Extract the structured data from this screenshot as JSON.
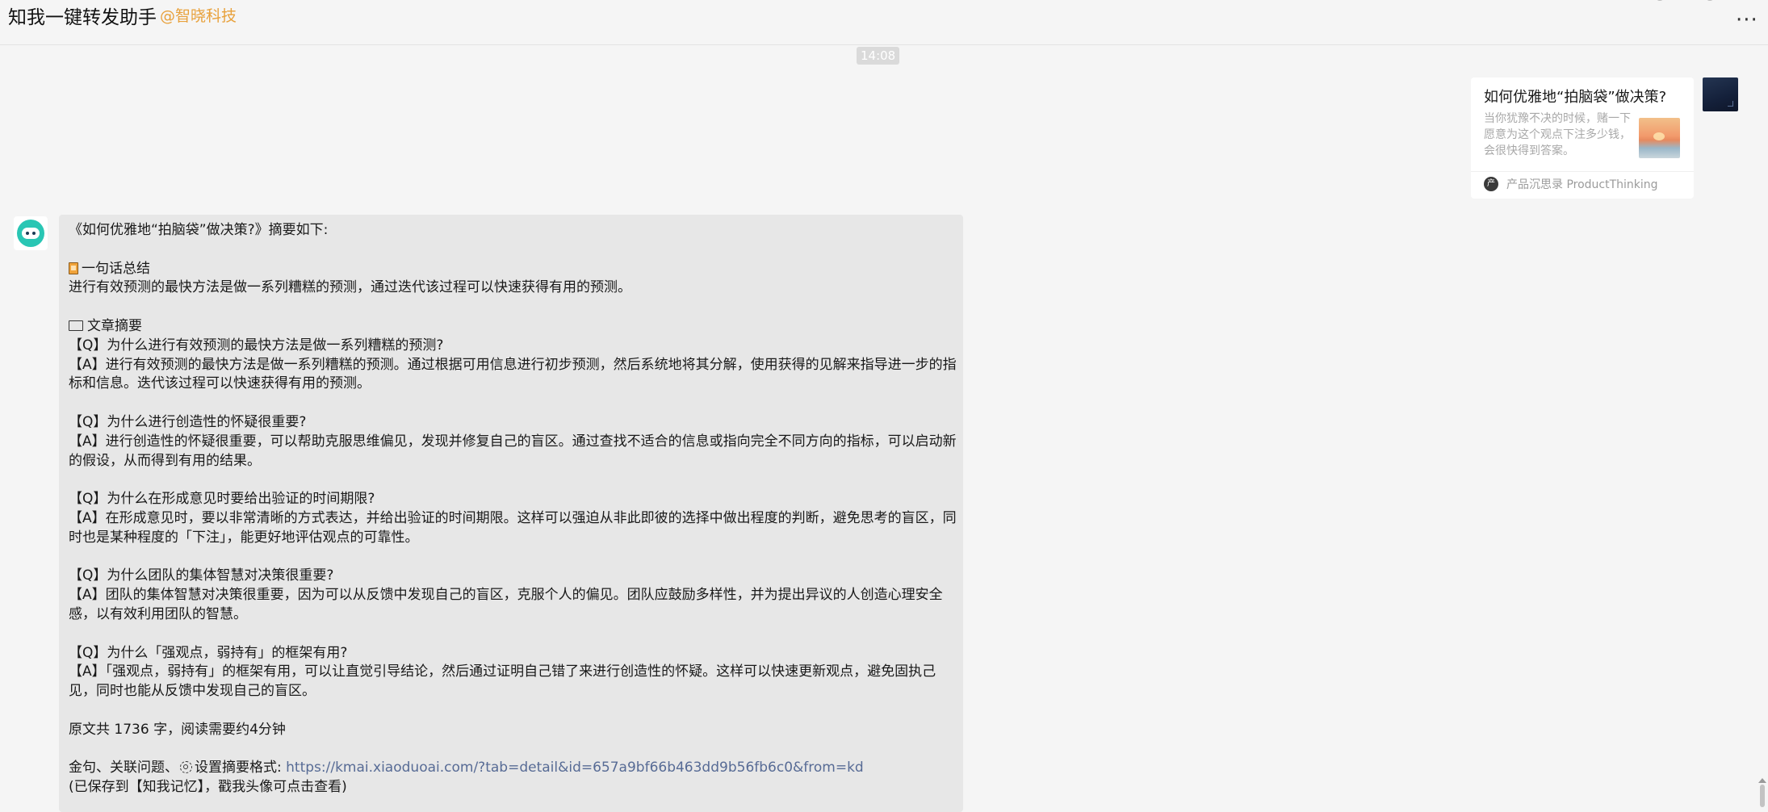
{
  "header": {
    "title": "知我一键转发助手",
    "org": "@智晓科技",
    "more_label": "···"
  },
  "timestamp": "14:08",
  "share_card": {
    "title": "如何优雅地“拍脑袋”做决策?",
    "description": "当你犹豫不决的时候，赌一下愿意为这个观点下注多少钱，会很快得到答案。",
    "source_icon": "产",
    "source": "产品沉思录 ProductThinking"
  },
  "message": {
    "intro": "《如何优雅地“拍脑袋”做决策?》摘要如下:",
    "summary_heading": "一句话总结",
    "summary_text": "进行有效预测的最快方法是做一系列糟糕的预测，通过迭代该过程可以快速获得有用的预测。",
    "article_heading": "文章摘要",
    "qa": [
      {
        "q": "【Q】为什么进行有效预测的最快方法是做一系列糟糕的预测?",
        "a": "【A】进行有效预测的最快方法是做一系列糟糕的预测。通过根据可用信息进行初步预测，然后系统地将其分解，使用获得的见解来指导进一步的指标和信息。迭代该过程可以快速获得有用的预测。"
      },
      {
        "q": "【Q】为什么进行创造性的怀疑很重要?",
        "a": "【A】进行创造性的怀疑很重要，可以帮助克服思维偏见，发现并修复自己的盲区。通过查找不适合的信息或指向完全不同方向的指标，可以启动新的假设，从而得到有用的结果。"
      },
      {
        "q": "【Q】为什么在形成意见时要给出验证的时间期限?",
        "a": "【A】在形成意见时，要以非常清晰的方式表达，并给出验证的时间期限。这样可以强迫从非此即彼的选择中做出程度的判断，避免思考的盲区，同时也是某种程度的「下注」，能更好地评估观点的可靠性。"
      },
      {
        "q": "【Q】为什么团队的集体智慧对决策很重要?",
        "a": "【A】团队的集体智慧对决策很重要，因为可以从反馈中发现自己的盲区，克服个人的偏见。团队应鼓励多样性，并为提出异议的人创造心理安全感，以有效利用团队的智慧。"
      },
      {
        "q": "【Q】为什么「强观点，弱持有」的框架有用?",
        "a": "【A】「强观点，弱持有」的框架有用，可以让直觉引导结论，然后通过证明自己错了来进行创造性的怀疑。这样可以快速更新观点，避免固执己见，同时也能从反馈中发现自己的盲区。"
      }
    ],
    "word_count": "原文共 1736 字，阅读需要约4分钟",
    "settings_prefix": "金句、关联问题、",
    "settings_label": "设置摘要格式:",
    "link": "https://kmai.xiaoduoai.com/?tab=detail&id=657a9bf66b463dd9b56fb6c0&from=kd",
    "saved_note": "(已保存到【知我记忆】，戳我头像可点击查看)"
  },
  "icons": {
    "summary": "book-icon",
    "article": "laptop-icon",
    "settings": "gear-icon"
  },
  "colors": {
    "link": "#576b95",
    "org": "#e8a13b",
    "bubble": "#e7e7e7",
    "background": "#f5f5f5"
  }
}
